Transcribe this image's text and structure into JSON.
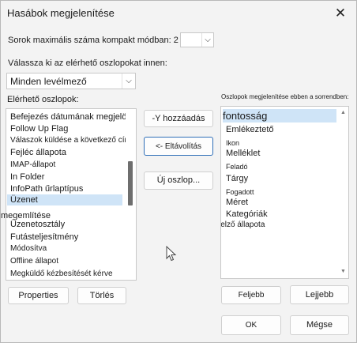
{
  "window": {
    "title": "Hasábok megjelenítése",
    "close_glyph": "✕"
  },
  "max_rows": {
    "label": "Sorok maximális száma kompakt módban: 2",
    "value": "",
    "arrow": "⌵"
  },
  "columns_from": {
    "label": "Válassza ki az elérhető oszlopokat innen:",
    "value": "Minden levélmező",
    "arrow": "⌵"
  },
  "available": {
    "label": "Elérhető oszlopok:",
    "items": [
      "Befejezés dátumának megjelölése",
      "Follow Up Flag",
      "Válaszok küldése a következő címzettnek",
      "Fejléc állapota",
      "IMAP-állapot",
      "In Folder",
      "InfoPath űrlaptípus",
      "Üzenet",
      "megemlítése",
      "Üzenetosztály",
      "Futásteljesítmény",
      "Módosítva",
      "Offline állapot",
      "Megküldő kézbesítését kérve"
    ],
    "selected_index": 7
  },
  "shown": {
    "label": "Oszlopok megjelenítése ebben a sorrendben:",
    "items": [
      "fontosság",
      "Emlékeztető",
      "Ikon",
      "Melléklet",
      "Feladó",
      "Tárgy",
      "Fogadott",
      "Méret",
      "Kategóriák",
      "jelző állapota"
    ],
    "selected_index": 0,
    "scroll_up": "▲",
    "scroll_down": "▼"
  },
  "buttons": {
    "add": "-Y hozzáadás",
    "remove": "<- Eltávolítás",
    "new_column": "Új oszlop...",
    "properties": "Properties",
    "delete": "Törlés",
    "move_up": "Feljebb",
    "move_down": "Lejjebb",
    "ok": "OK",
    "cancel": "Mégse"
  }
}
